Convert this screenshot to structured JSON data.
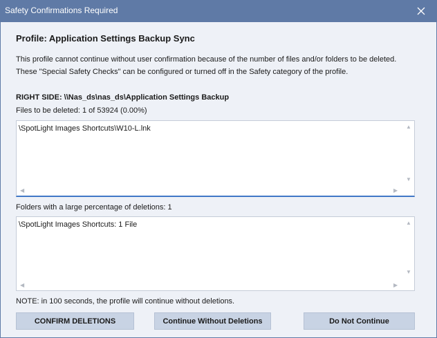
{
  "window": {
    "title": "Safety Confirmations Required",
    "close_icon": "close-icon"
  },
  "profile_title": "Profile: Application Settings Backup Sync",
  "description": {
    "line1": "This profile cannot continue without user confirmation because of the number of files and/or folders to be deleted.",
    "line2": "These \"Special Safety Checks\" can be configured or turned off in the Safety category of the profile."
  },
  "side_heading": "RIGHT SIDE: \\\\Nas_ds\\nas_ds\\Application Settings Backup",
  "files": {
    "label": "Files to be deleted: 1 of 53924 (0.00%)",
    "items": [
      "\\SpotLight Images Shortcuts\\W10-L.lnk"
    ]
  },
  "folders": {
    "label": "Folders with a large percentage of deletions: 1",
    "items": [
      "\\SpotLight Images Shortcuts: 1 File"
    ]
  },
  "note": "NOTE: in 100 seconds, the profile will continue without deletions.",
  "buttons": {
    "confirm": "CONFIRM DELETIONS",
    "continue_without": "Continue Without Deletions",
    "do_not_continue": "Do Not Continue"
  },
  "colors": {
    "titlebar": "#5f7aa6",
    "background": "#eef1f7",
    "button": "#c8d3e4",
    "focus_underline": "#3f77c7"
  }
}
